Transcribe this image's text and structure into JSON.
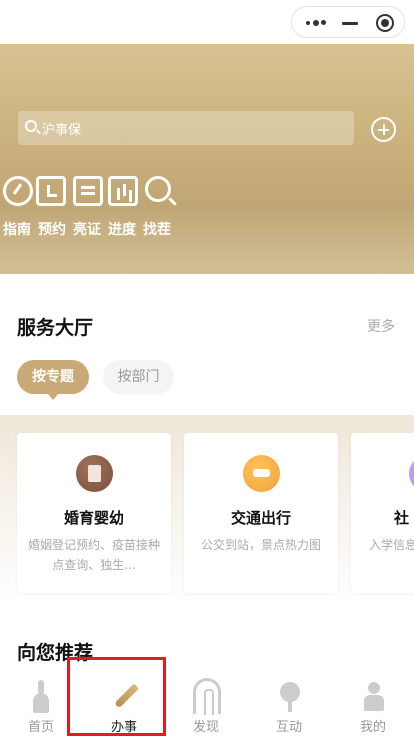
{
  "search": {
    "placeholder": "沪事保"
  },
  "quick_actions": [
    {
      "label": "指南",
      "icon": "dial-icon"
    },
    {
      "label": "预约",
      "icon": "clock-icon"
    },
    {
      "label": "亮证",
      "icon": "id-card-icon"
    },
    {
      "label": "进度",
      "icon": "progress-icon"
    },
    {
      "label": "找茬",
      "icon": "search-icon"
    }
  ],
  "service_hall": {
    "title": "服务大厅",
    "more": "更多",
    "tabs": [
      {
        "label": "按专题",
        "active": true
      },
      {
        "label": "按部门",
        "active": false
      }
    ],
    "cards": [
      {
        "title": "婚育婴幼",
        "desc": "婚姻登记预约、疫苗接种点查询、独生...",
        "icon": "certificate-icon",
        "color": "#8a5d48"
      },
      {
        "title": "交通出行",
        "desc": "公交到站，景点热力图",
        "icon": "car-icon",
        "color": "#f5a93f"
      },
      {
        "title": "社",
        "desc": "入学信息示范高",
        "icon": "community-icon",
        "color": "#b69ae6"
      }
    ]
  },
  "recommend": {
    "title": "向您推荐"
  },
  "tabbar": [
    {
      "label": "首页",
      "icon": "pagoda-icon",
      "active": false
    },
    {
      "label": "办事",
      "icon": "pen-icon",
      "active": true
    },
    {
      "label": "发现",
      "icon": "arch-icon",
      "active": false
    },
    {
      "label": "互动",
      "icon": "flower-icon",
      "active": false
    },
    {
      "label": "我的",
      "icon": "person-icon",
      "active": false
    }
  ],
  "colors": {
    "accent": "#c9a977",
    "highlight": "#e11d1d"
  }
}
